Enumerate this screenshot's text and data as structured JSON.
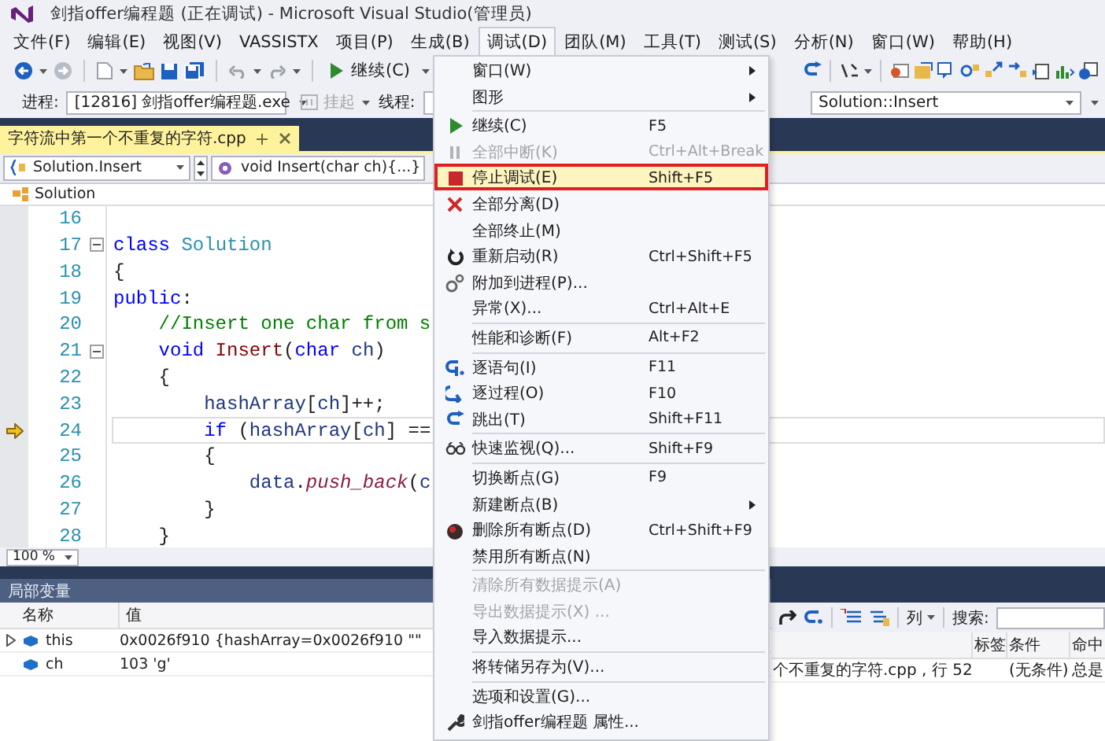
{
  "window": {
    "title": "剑指offer编程题 (正在调试) - Microsoft Visual Studio(管理员)"
  },
  "menu_bar": [
    {
      "label": "文件(F)",
      "selected": false
    },
    {
      "label": "编辑(E)",
      "selected": false
    },
    {
      "label": "视图(V)",
      "selected": false
    },
    {
      "label": "VASSISTX",
      "selected": false
    },
    {
      "label": "项目(P)",
      "selected": false
    },
    {
      "label": "生成(B)",
      "selected": false
    },
    {
      "label": "调试(D)",
      "selected": true
    },
    {
      "label": "团队(M)",
      "selected": false
    },
    {
      "label": "工具(T)",
      "selected": false
    },
    {
      "label": "测试(S)",
      "selected": false
    },
    {
      "label": "分析(N)",
      "selected": false
    },
    {
      "label": "窗口(W)",
      "selected": false
    },
    {
      "label": "帮助(H)",
      "selected": false
    }
  ],
  "toolbar": {
    "continue_button": "继续(C)"
  },
  "debug_location_bar": {
    "process_label": "进程:",
    "process": "[12816] 剑指offer编程题.exe",
    "suspend_button": {
      "label": "挂起",
      "disabled": true
    },
    "thread_label": "线程:",
    "stack_frame": "Solution::Insert"
  },
  "editor": {
    "tabs": [
      {
        "label": "字符流中第一个不重复的字符.cpp",
        "selected": true
      }
    ],
    "scope": "Solution.Insert",
    "member": "void Insert(char ch){...}",
    "class_bar": "Solution",
    "lines": [
      {
        "number": "16",
        "fold": false,
        "current": false
      },
      {
        "number": "17",
        "fold": true,
        "current": false,
        "tokens": [
          {
            "kind": "keyword",
            "text": "class"
          },
          {
            "kind": "type",
            "text": " Solution"
          }
        ]
      },
      {
        "number": "18",
        "fold": false,
        "current": false,
        "tokens": [
          {
            "kind": "plain",
            "text": "{"
          }
        ]
      },
      {
        "number": "19",
        "fold": false,
        "current": false,
        "tokens": [
          {
            "kind": "keyword",
            "text": "public"
          },
          {
            "kind": "plain",
            "text": ":"
          }
        ]
      },
      {
        "number": "20",
        "fold": false,
        "current": false,
        "tokens": [
          {
            "kind": "comment",
            "text": "    //Insert one char from s"
          }
        ]
      },
      {
        "number": "21",
        "fold": true,
        "current": false,
        "tokens": [
          {
            "kind": "keyword",
            "text": "    void"
          },
          {
            "kind": "function",
            "text": " Insert"
          },
          {
            "kind": "plain",
            "text": "("
          },
          {
            "kind": "keyword",
            "text": "char"
          },
          {
            "kind": "variable",
            "text": " ch"
          },
          {
            "kind": "plain",
            "text": ")"
          }
        ]
      },
      {
        "number": "22",
        "fold": false,
        "current": false,
        "tokens": [
          {
            "kind": "plain",
            "text": "    {"
          }
        ]
      },
      {
        "number": "23",
        "fold": false,
        "current": false,
        "tokens": [
          {
            "kind": "variable",
            "text": "        hashArray"
          },
          {
            "kind": "plain",
            "text": "["
          },
          {
            "kind": "variable",
            "text": "ch"
          },
          {
            "kind": "plain",
            "text": "]++;"
          }
        ]
      },
      {
        "number": "24",
        "fold": false,
        "current": true,
        "tokens": [
          {
            "kind": "keyword",
            "text": "        if"
          },
          {
            "kind": "plain",
            "text": " ("
          },
          {
            "kind": "variable",
            "text": "hashArray"
          },
          {
            "kind": "plain",
            "text": "["
          },
          {
            "kind": "variable",
            "text": "ch"
          },
          {
            "kind": "plain",
            "text": "] =="
          }
        ]
      },
      {
        "number": "25",
        "fold": false,
        "current": false,
        "tokens": [
          {
            "kind": "plain",
            "text": "        {"
          }
        ]
      },
      {
        "number": "26",
        "fold": false,
        "current": false,
        "tokens": [
          {
            "kind": "variable",
            "text": "            data"
          },
          {
            "kind": "plain",
            "text": "."
          },
          {
            "kind": "call",
            "text": "push_back"
          },
          {
            "kind": "plain",
            "text": "("
          },
          {
            "kind": "variable",
            "text": "c"
          }
        ]
      },
      {
        "number": "27",
        "fold": false,
        "current": false,
        "tokens": [
          {
            "kind": "plain",
            "text": "        }"
          }
        ]
      },
      {
        "number": "28",
        "fold": false,
        "current": false,
        "tokens": [
          {
            "kind": "plain",
            "text": "    }"
          }
        ]
      }
    ],
    "zoom": "100 %"
  },
  "locals": {
    "title": "局部变量",
    "columns": [
      "名称",
      "值"
    ],
    "rows": [
      {
        "name": "this",
        "value": "0x0026f910 {hashArray=0x0026f910 \"\"",
        "expandable": true
      },
      {
        "name": "ch",
        "value": "103 'g'",
        "expandable": false
      }
    ]
  },
  "breakpoints": {
    "columns_button": "列",
    "search_label": "搜索:",
    "columns": [
      "标签",
      "条件",
      "命中"
    ],
    "rows": [
      {
        "location": "个不重复的字符.cpp , 行 52",
        "condition": "(无条件)",
        "hit_count": "总是"
      }
    ]
  },
  "debug_menu": {
    "groups": [
      [
        {
          "label": "窗口(W)",
          "submenu": true,
          "disabled": false,
          "selected": false
        },
        {
          "label": "图形",
          "submenu": true,
          "disabled": false,
          "selected": false
        }
      ],
      [
        {
          "label": "继续(C)",
          "shortcut": "F5",
          "submenu": false,
          "disabled": false,
          "selected": false
        },
        {
          "label": "全部中断(K)",
          "shortcut": "Ctrl+Alt+Break",
          "submenu": false,
          "disabled": true,
          "selected": false
        },
        {
          "label": "停止调试(E)",
          "shortcut": "Shift+F5",
          "submenu": false,
          "disabled": false,
          "selected": true
        },
        {
          "label": "全部分离(D)",
          "submenu": false,
          "disabled": false,
          "selected": false
        },
        {
          "label": "全部终止(M)",
          "submenu": false,
          "disabled": false,
          "selected": false
        },
        {
          "label": "重新启动(R)",
          "shortcut": "Ctrl+Shift+F5",
          "submenu": false,
          "disabled": false,
          "selected": false
        },
        {
          "label": "附加到进程(P)...",
          "submenu": false,
          "disabled": false,
          "selected": false
        },
        {
          "label": "异常(X)...",
          "shortcut": "Ctrl+Alt+E",
          "submenu": false,
          "disabled": false,
          "selected": false
        }
      ],
      [
        {
          "label": "性能和诊断(F)",
          "shortcut": "Alt+F2",
          "submenu": false,
          "disabled": false,
          "selected": false
        }
      ],
      [
        {
          "label": "逐语句(I)",
          "shortcut": "F11",
          "submenu": false,
          "disabled": false,
          "selected": false
        },
        {
          "label": "逐过程(O)",
          "shortcut": "F10",
          "submenu": false,
          "disabled": false,
          "selected": false
        },
        {
          "label": "跳出(T)",
          "shortcut": "Shift+F11",
          "submenu": false,
          "disabled": false,
          "selected": false
        }
      ],
      [
        {
          "label": "快速监视(Q)...",
          "shortcut": "Shift+F9",
          "submenu": false,
          "disabled": false,
          "selected": false
        }
      ],
      [
        {
          "label": "切换断点(G)",
          "shortcut": "F9",
          "submenu": false,
          "disabled": false,
          "selected": false
        },
        {
          "label": "新建断点(B)",
          "submenu": true,
          "disabled": false,
          "selected": false
        },
        {
          "label": "删除所有断点(D)",
          "shortcut": "Ctrl+Shift+F9",
          "submenu": false,
          "disabled": false,
          "selected": false
        },
        {
          "label": "禁用所有断点(N)",
          "submenu": false,
          "disabled": false,
          "selected": false
        }
      ],
      [
        {
          "label": "清除所有数据提示(A)",
          "submenu": false,
          "disabled": true,
          "selected": false
        },
        {
          "label": "导出数据提示(X) ...",
          "submenu": false,
          "disabled": true,
          "selected": false
        },
        {
          "label": "导入数据提示...",
          "submenu": false,
          "disabled": false,
          "selected": false
        }
      ],
      [
        {
          "label": "将转储另存为(V)...",
          "submenu": false,
          "disabled": false,
          "selected": false
        }
      ],
      [
        {
          "label": "选项和设置(G)...",
          "submenu": false,
          "disabled": false,
          "selected": false
        },
        {
          "label": "剑指offer编程题 属性...",
          "submenu": false,
          "disabled": false,
          "selected": false
        }
      ]
    ]
  }
}
